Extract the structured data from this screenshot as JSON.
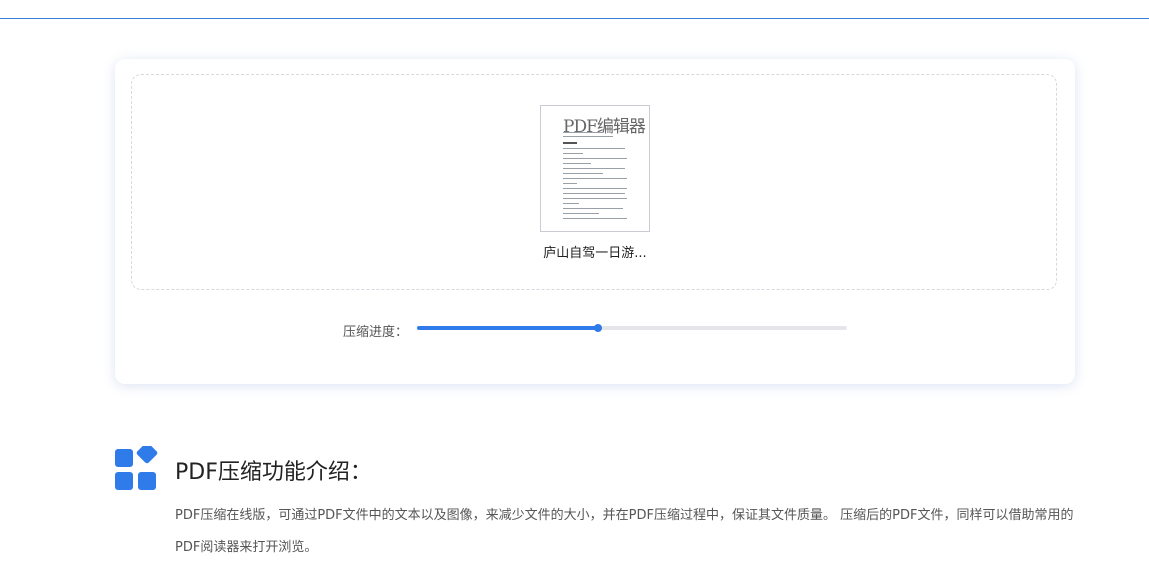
{
  "upload": {
    "thumbnail_title": "PDF编辑器",
    "file_name": "庐山自驾一日游..."
  },
  "progress": {
    "label": "压缩进度：",
    "fraction": 0.42
  },
  "feature": {
    "icon": "apps-grid-icon",
    "heading": "PDF压缩功能介绍：",
    "description": "PDF压缩在线版，可通过PDF文件中的文本以及图像，来减少文件的大小，并在PDF压缩过程中，保证其文件质量。 压缩后的PDF文件，同样可以借助常用的PDF阅读器来打开浏览。"
  },
  "colors": {
    "accent": "#2f7bea",
    "track": "#e4e6ea"
  }
}
